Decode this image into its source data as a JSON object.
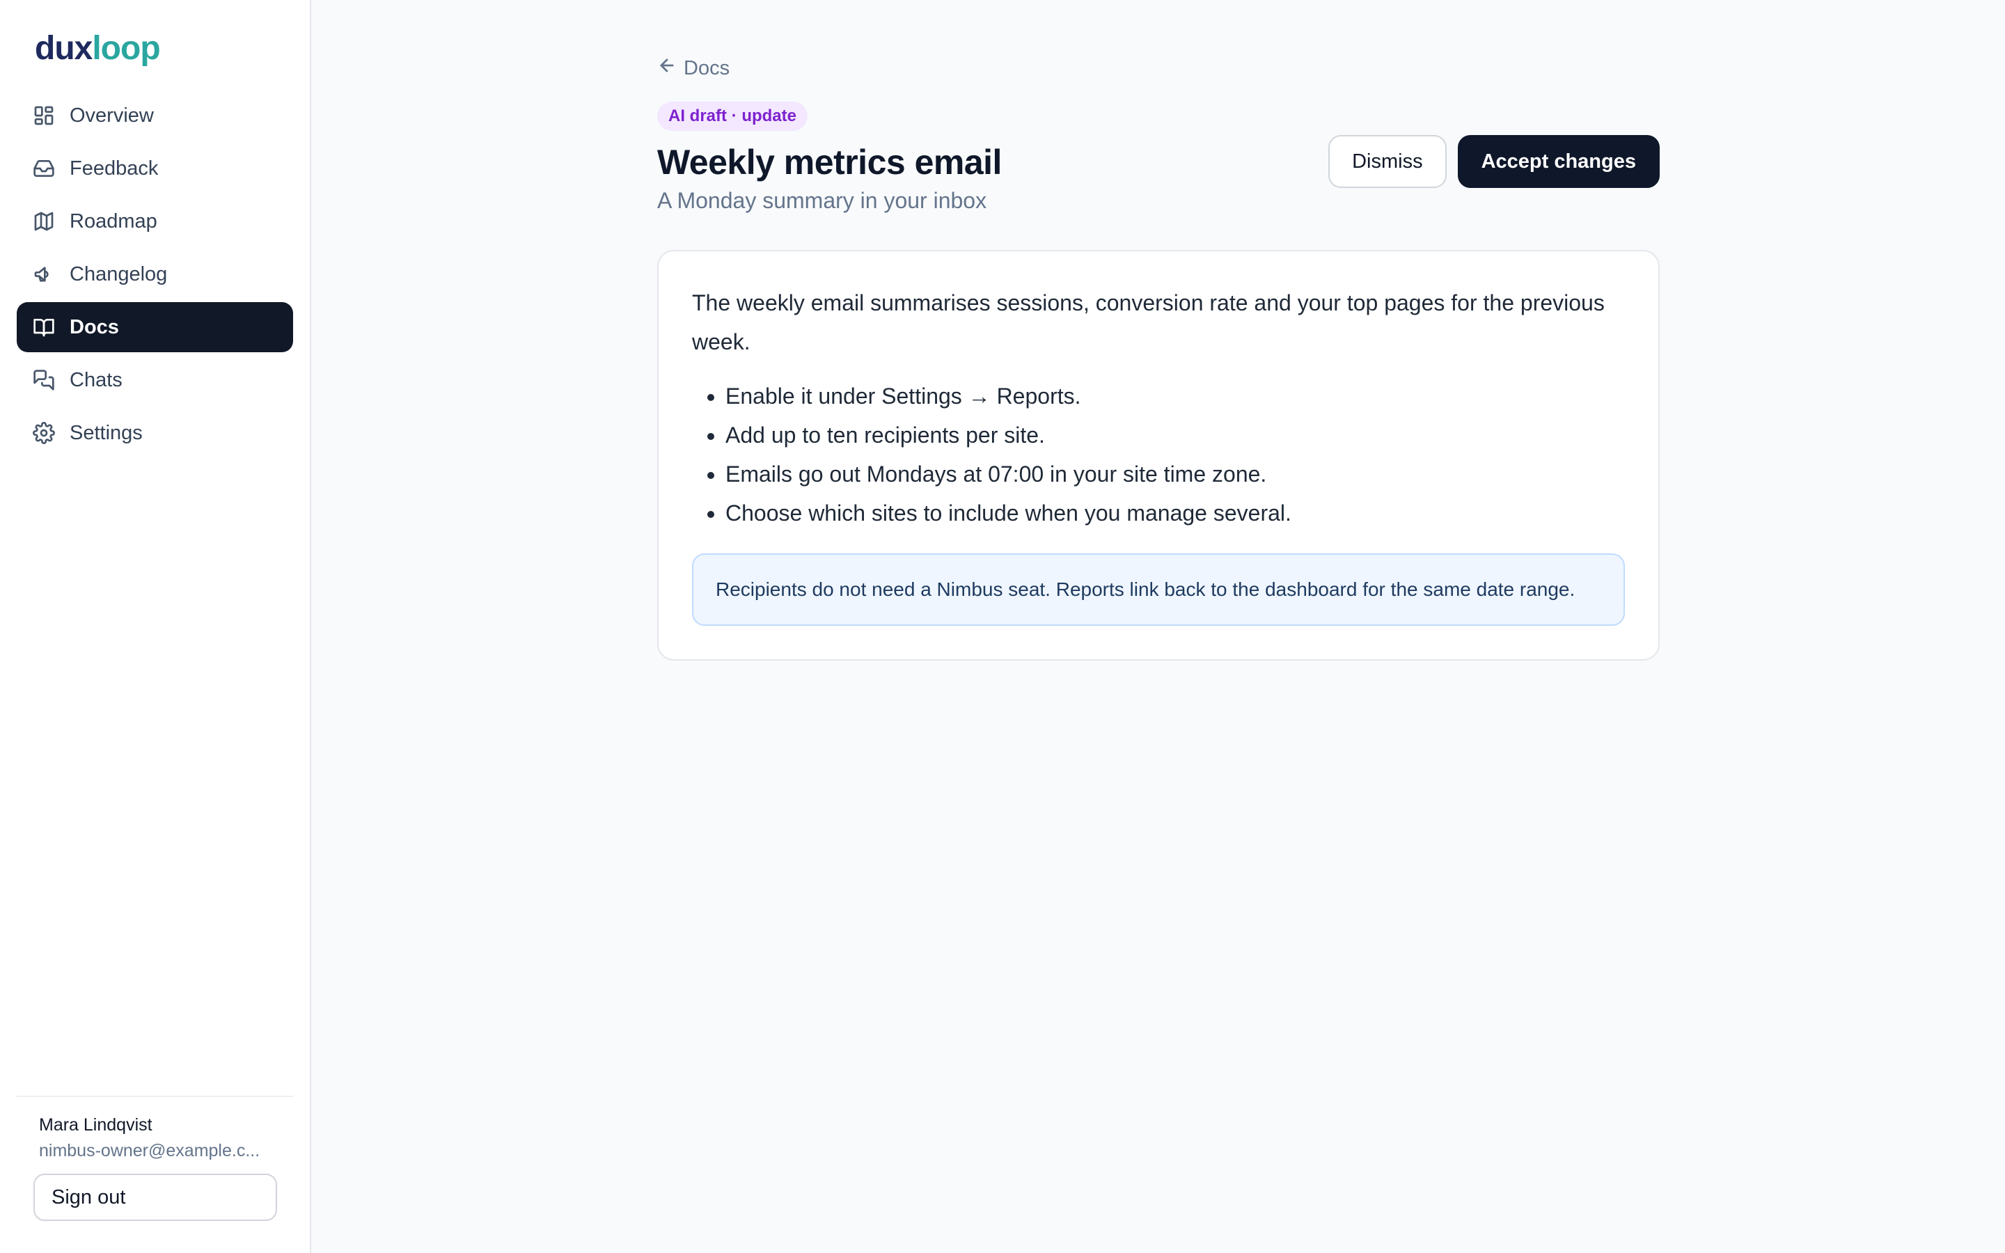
{
  "brand": {
    "part1": "dux",
    "part2": "loop"
  },
  "sidebar": {
    "items": [
      {
        "label": "Overview",
        "icon": "grid-icon"
      },
      {
        "label": "Feedback",
        "icon": "inbox-icon"
      },
      {
        "label": "Roadmap",
        "icon": "map-icon"
      },
      {
        "label": "Changelog",
        "icon": "megaphone-icon"
      },
      {
        "label": "Docs",
        "icon": "book-icon",
        "active": true
      },
      {
        "label": "Chats",
        "icon": "chat-icon"
      },
      {
        "label": "Settings",
        "icon": "gear-icon"
      }
    ],
    "user": {
      "name": "Mara Lindqvist",
      "email": "nimbus-owner@example.c..."
    },
    "sign_out_label": "Sign out"
  },
  "main": {
    "back_label": "Docs",
    "badge": "AI draft · update",
    "title": "Weekly metrics email",
    "subtitle": "A Monday summary in your inbox",
    "actions": {
      "dismiss_label": "Dismiss",
      "accept_label": "Accept changes"
    },
    "card": {
      "intro": "The weekly email summarises sessions, conversion rate and your top pages for the previous week.",
      "bullets": [
        "Enable it under Settings → Reports.",
        "Add up to ten recipients per site.",
        "Emails go out Mondays at 07:00 in your site time zone.",
        "Choose which sites to include when you manage several."
      ],
      "note": "Recipients do not need a Nimbus seat. Reports link back to the dashboard for the same date range."
    }
  },
  "colors": {
    "sidebar_active_bg": "#111827",
    "primary_button": "#0f172a",
    "badge_bg": "#f3e8ff",
    "badge_text": "#7e22ce",
    "note_bg": "#eff6ff",
    "brand_dark": "#1e2a5e",
    "brand_teal": "#2aa6a0"
  }
}
